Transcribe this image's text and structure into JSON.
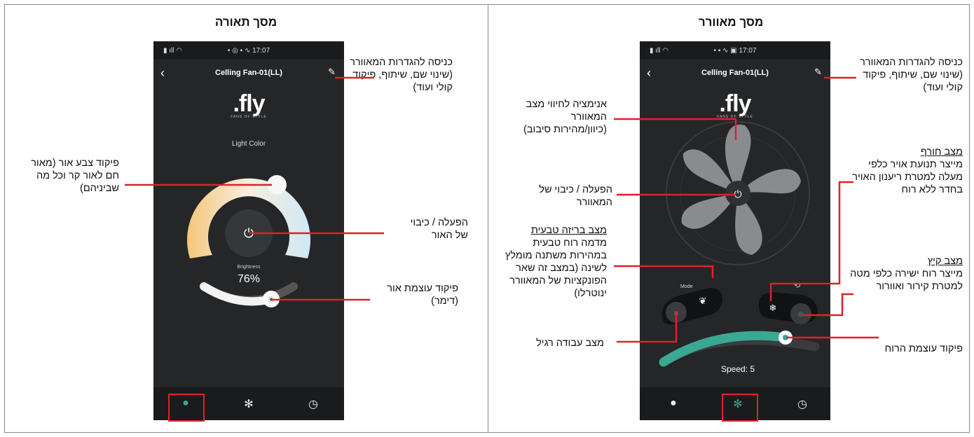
{
  "light_screen": {
    "heading": "מסך תאורה",
    "status_time": "17:07",
    "app_title": "Celling Fan-01(LL)",
    "brand": ".fly",
    "brand_sub": "FANS OF STYLE",
    "light_color_label": "Light Color",
    "brightness_label": "Brightness",
    "brightness_value": "76%",
    "brightness_level": 0.76,
    "annotations": {
      "settings": "כניסה להגדרות המאוורר (שינוי שם, שיתוף, פיקוד קולי ועוד)",
      "color": "פיקוד צבע אור (מאור חם לאור קר וכל מה שביניהם)",
      "power": "הפעלה / כיבוי של האור",
      "dimmer": "פיקוד עוצמת אור (דימר)"
    }
  },
  "fan_screen": {
    "heading": "מסך מאוורר",
    "status_time": "17:07",
    "app_title": "Celling Fan-01(LL)",
    "brand": ".fly",
    "brand_sub": "FANS OF STYLE",
    "mode_label": "Mode",
    "speed_label": "Speed: 5",
    "speed_level": 0.83,
    "annotations": {
      "settings": "כניסה להגדרות המאוורר (שינוי שם, שיתוף, פיקוד קולי ועוד)",
      "animation": "אנימציה לחיווי מצב המאוורר (כיוון/מהירות סיבוב)",
      "power": "הפעלה / כיבוי של המאוורר",
      "breeze_title": "מצב בריזה טבעית",
      "breeze_text": "מדמה רוח טבעית במהירות משתנה מומלץ לשינה (במצב זה שאר הפונקציות של המאוורר ינוטרלו)",
      "normal": "מצב עבודה רגיל",
      "winter_title": "מצב חורף",
      "winter_text": "מייצר תנועת אויר כלפי מעלה למטרת ריענון האויר בחדר ללא רוח",
      "summer_title": "מצב קיץ",
      "summer_text": "מייצר רוח ישירה כלפי מטה למטרת קירור ואוורור",
      "speed": "פיקוד עוצמת הרוח"
    }
  },
  "colors": {
    "annotation_line": "#e0202a",
    "accent_teal": "#3aa892",
    "phone_bg": "#252628"
  }
}
